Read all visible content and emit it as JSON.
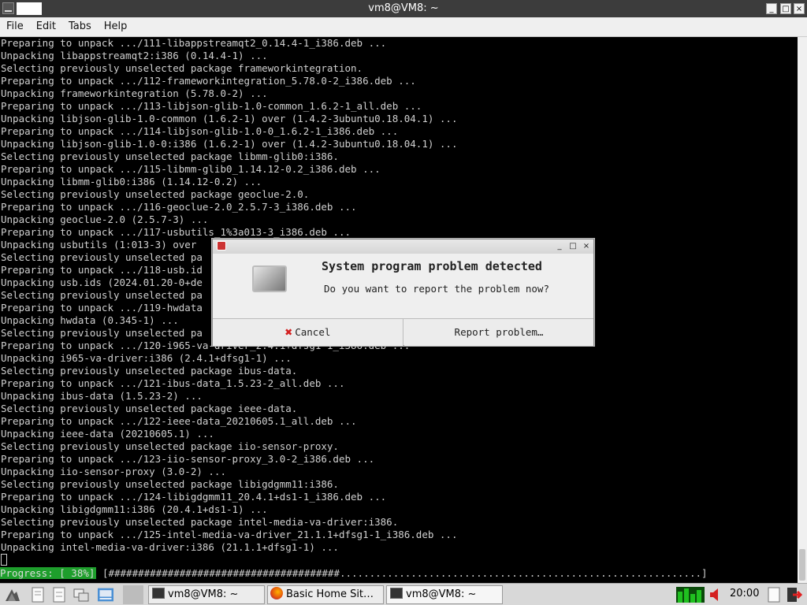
{
  "window": {
    "title": "vm8@VM8: ~",
    "controls": {
      "minimize": "_",
      "maximize": "□",
      "close": "×"
    }
  },
  "menu": [
    "File",
    "Edit",
    "Tabs",
    "Help"
  ],
  "terminal": {
    "lines": [
      "Preparing to unpack .../111-libappstreamqt2_0.14.4-1_i386.deb ...",
      "Unpacking libappstreamqt2:i386 (0.14.4-1) ...",
      "Selecting previously unselected package frameworkintegration.",
      "Preparing to unpack .../112-frameworkintegration_5.78.0-2_i386.deb ...",
      "Unpacking frameworkintegration (5.78.0-2) ...",
      "Preparing to unpack .../113-libjson-glib-1.0-common_1.6.2-1_all.deb ...",
      "Unpacking libjson-glib-1.0-common (1.6.2-1) over (1.4.2-3ubuntu0.18.04.1) ...",
      "Preparing to unpack .../114-libjson-glib-1.0-0_1.6.2-1_i386.deb ...",
      "Unpacking libjson-glib-1.0-0:i386 (1.6.2-1) over (1.4.2-3ubuntu0.18.04.1) ...",
      "Selecting previously unselected package libmm-glib0:i386.",
      "Preparing to unpack .../115-libmm-glib0_1.14.12-0.2_i386.deb ...",
      "Unpacking libmm-glib0:i386 (1.14.12-0.2) ...",
      "Selecting previously unselected package geoclue-2.0.",
      "Preparing to unpack .../116-geoclue-2.0_2.5.7-3_i386.deb ...",
      "Unpacking geoclue-2.0 (2.5.7-3) ...",
      "Preparing to unpack .../117-usbutils_1%3a013-3_i386.deb ...",
      "Unpacking usbutils (1:013-3) over",
      "Selecting previously unselected pa",
      "Preparing to unpack .../118-usb.id",
      "Unpacking usb.ids (2024.01.20-0+de",
      "Selecting previously unselected pa",
      "Preparing to unpack .../119-hwdata",
      "Unpacking hwdata (0.345-1) ...",
      "Selecting previously unselected pa",
      "Preparing to unpack .../120-i965-va-driver_2.4.1+dfsg1-1_i386.deb ...",
      "Unpacking i965-va-driver:i386 (2.4.1+dfsg1-1) ...",
      "Selecting previously unselected package ibus-data.",
      "Preparing to unpack .../121-ibus-data_1.5.23-2_all.deb ...",
      "Unpacking ibus-data (1.5.23-2) ...",
      "Selecting previously unselected package ieee-data.",
      "Preparing to unpack .../122-ieee-data_20210605.1_all.deb ...",
      "Unpacking ieee-data (20210605.1) ...",
      "Selecting previously unselected package iio-sensor-proxy.",
      "Preparing to unpack .../123-iio-sensor-proxy_3.0-2_i386.deb ...",
      "Unpacking iio-sensor-proxy (3.0-2) ...",
      "Selecting previously unselected package libigdgmm11:i386.",
      "Preparing to unpack .../124-libigdgmm11_20.4.1+ds1-1_i386.deb ...",
      "Unpacking libigdgmm11:i386 (20.4.1+ds1-1) ...",
      "Selecting previously unselected package intel-media-va-driver:i386.",
      "Preparing to unpack .../125-intel-media-va-driver_21.1.1+dfsg1-1_i386.deb ...",
      "Unpacking intel-media-va-driver:i386 (21.1.1+dfsg1-1) ..."
    ],
    "progress_label": "Progress: [ 38%]",
    "progress_bar": " [#######################################.............................................................]",
    "progress_percent": 38
  },
  "dialog": {
    "title": "System program problem detected",
    "message": "Do you want to report the problem now?",
    "cancel_label": "Cancel",
    "report_label": "Report problem…",
    "controls": {
      "minimize": "_",
      "maximize": "□",
      "close": "×"
    }
  },
  "taskbar": {
    "tasks": [
      {
        "label": "vm8@VM8: ~",
        "icon": "terminal-icon"
      },
      {
        "label": "Basic Home Sit…",
        "icon": "firefox-icon"
      },
      {
        "label": "vm8@VM8: ~",
        "icon": "terminal-icon"
      }
    ],
    "clock": "20:00"
  },
  "colors": {
    "progress_bg": "#1e9e2c",
    "cancel_icon": "#d32020",
    "titlebar": "#3c3c3c"
  }
}
